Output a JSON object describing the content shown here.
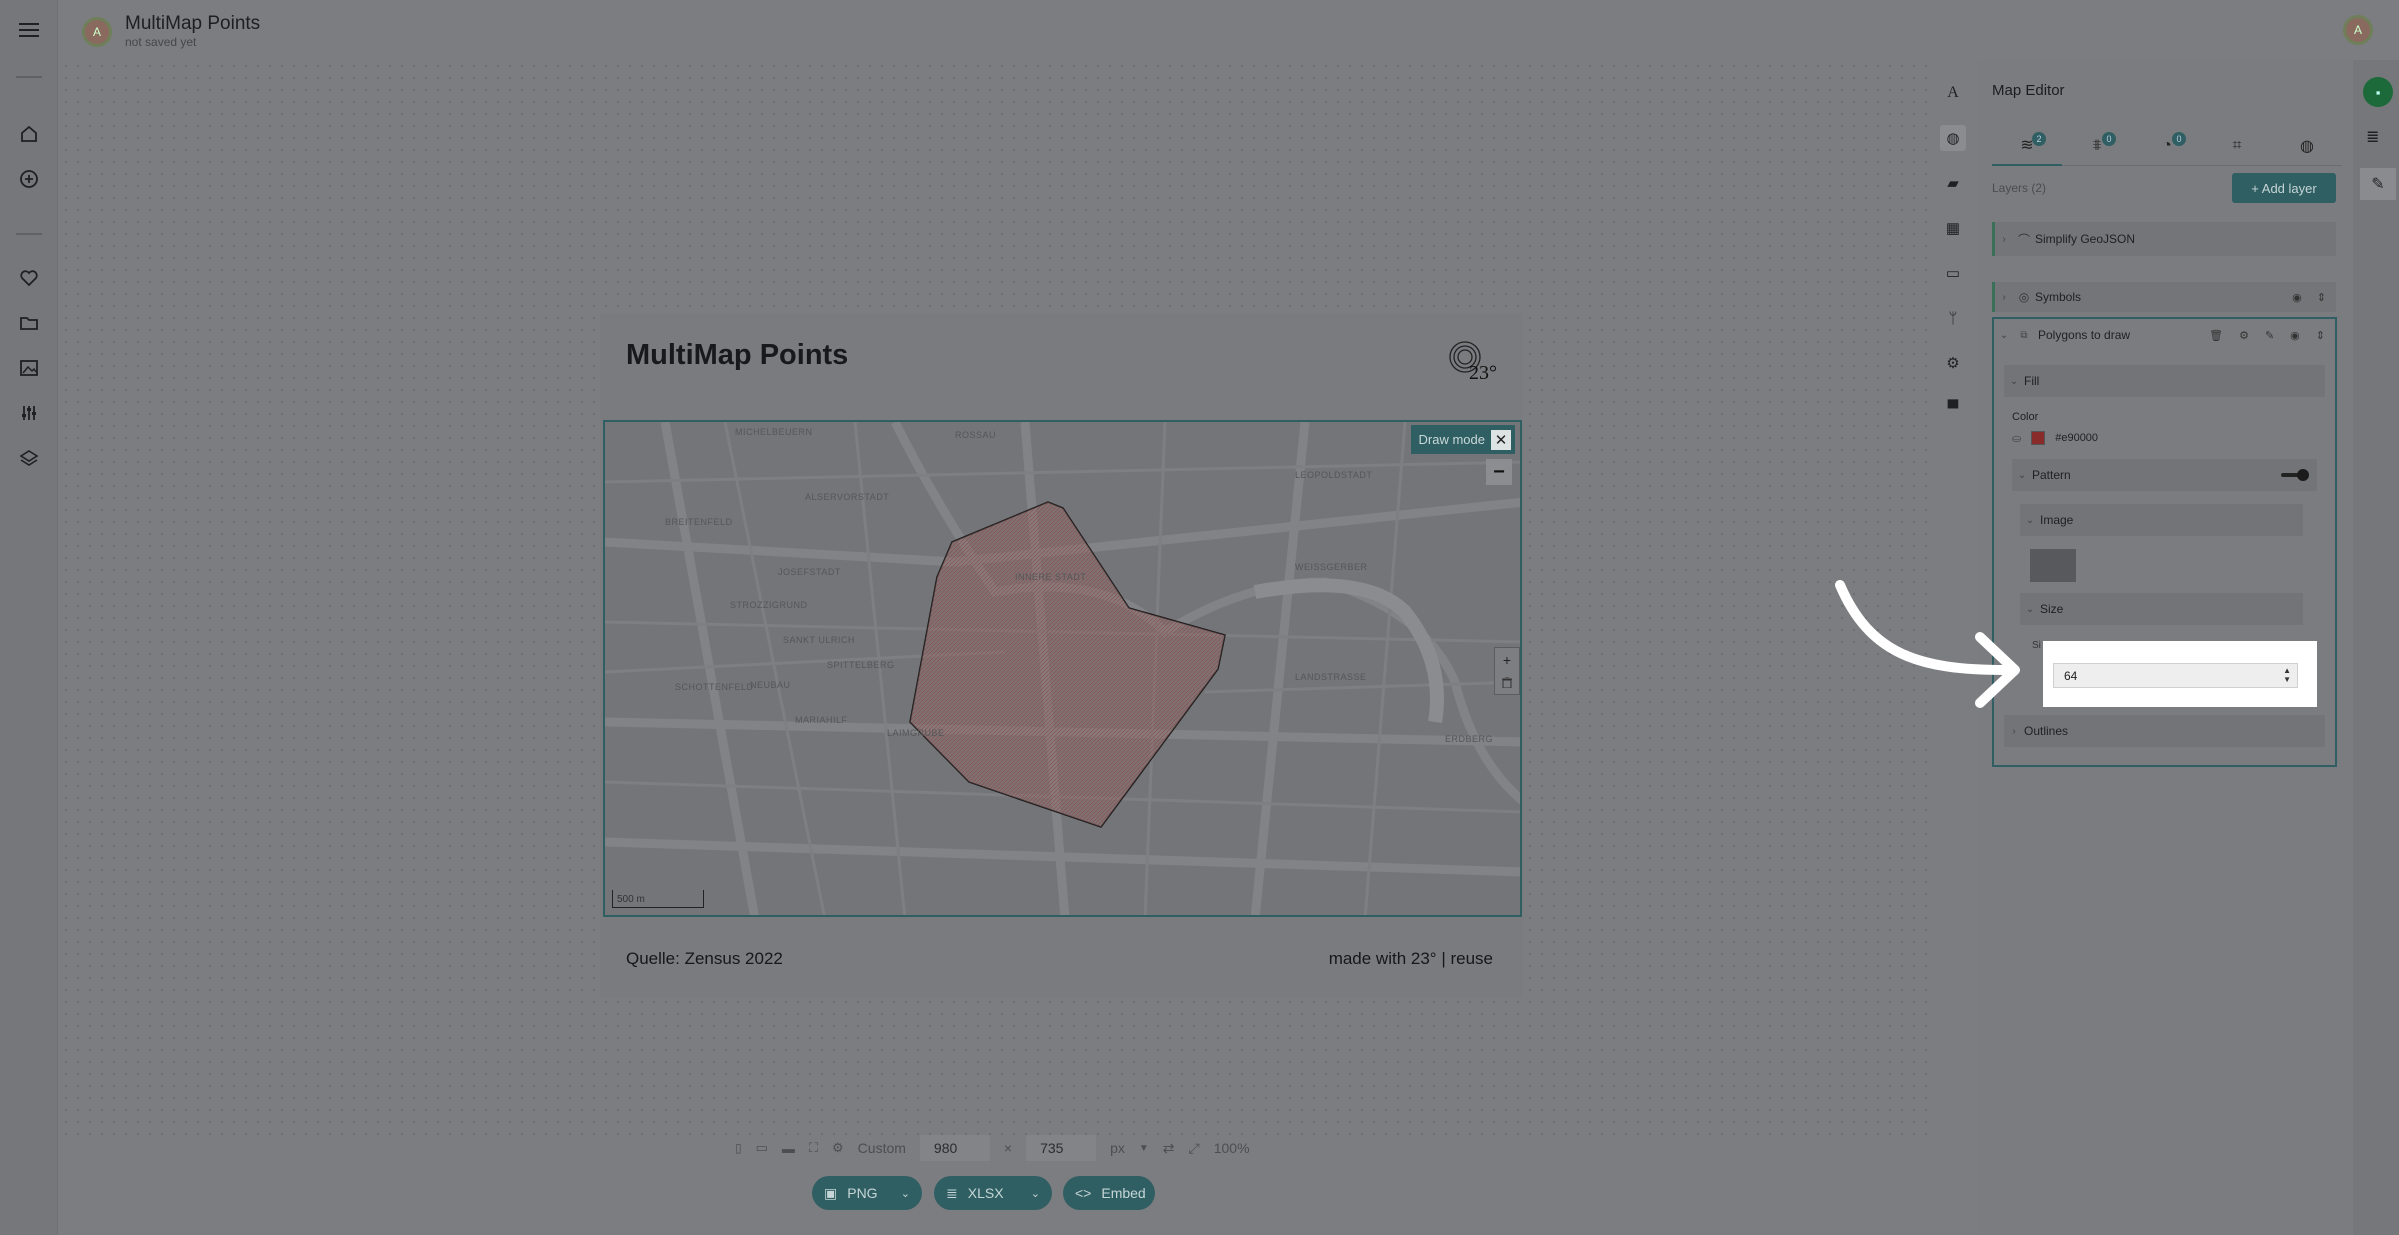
{
  "header": {
    "avatar_letter": "A",
    "title": "MultiMap Points",
    "subtitle": "not saved yet"
  },
  "left_nav": {
    "items": [
      "menu-icon",
      "home-icon",
      "add-icon",
      "heart-icon",
      "folder-icon",
      "image-icon",
      "sliders-icon",
      "layers-icon"
    ]
  },
  "card": {
    "title": "MultiMap Points",
    "logo_text": "23°",
    "footer_left": "Quelle: Zensus 2022",
    "footer_right": "made with 23° | reuse"
  },
  "map": {
    "draw_mode_label": "Draw mode",
    "close_glyph": "✕",
    "zoom_out": "−",
    "zoom_in": "+",
    "trash": "🗑",
    "scale_label": "500 m",
    "polygon_fill": "#e90000",
    "labels": [
      "MICHELBEUERN",
      "ROSSAU",
      "LEOPOLDSTADT",
      "ALSERVORSTADT",
      "BREITENFELD",
      "JOSEFSTADT",
      "INNERE STADT",
      "WEISSGERBER",
      "STROZZIGRUND",
      "SANKT ULRICH",
      "SPITTELBERG",
      "SCHOTTENFELD",
      "NEUBAU",
      "LANDSTRASSE",
      "MARIAHILF",
      "LAIMGRUBE",
      "ERDBERG"
    ]
  },
  "size_toolbar": {
    "preset": "Custom",
    "width": "980",
    "times": "×",
    "height": "735",
    "unit": "px",
    "zoom": "100%"
  },
  "export": {
    "png": "PNG",
    "xlsx": "XLSX",
    "embed": "Embed"
  },
  "editor": {
    "title": "Map Editor",
    "tab_badges": [
      "2",
      "0",
      "0"
    ],
    "layers_count": "Layers (2)",
    "add_layer": "+ Add layer",
    "layers": [
      {
        "name": "Simplify GeoJSON"
      },
      {
        "name": "Symbols"
      },
      {
        "name": "Polygons to draw"
      }
    ],
    "fill_section": "Fill",
    "color_label": "Color",
    "color_value": "#e90000",
    "pattern_section": "Pattern",
    "image_section": "Image",
    "size_section": "Size",
    "size_label": "Si",
    "size_value": "64",
    "outlines_section": "Outlines"
  },
  "colors": {
    "accent": "#2f5e63",
    "save": "#1c6a3a",
    "polygon": "#e90000"
  }
}
